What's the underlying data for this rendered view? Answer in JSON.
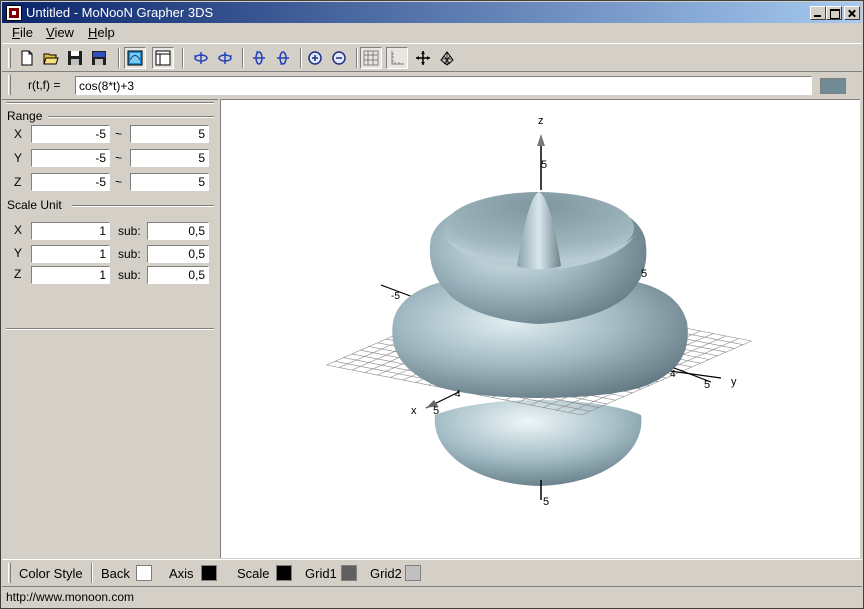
{
  "window": {
    "title": "Untitled - MoNooN Grapher 3DS"
  },
  "menu": {
    "file": "File",
    "view": "View",
    "help": "Help"
  },
  "toolbar": {
    "buttons": [
      "new-file-icon",
      "open-folder-icon",
      "save-icon",
      "save-bmp-icon",
      "view-graph-icon",
      "panel-toggle-icon",
      "rotate-left-icon",
      "rotate-right-icon",
      "tilt-up-icon",
      "tilt-down-icon",
      "zoom-in-icon",
      "zoom-out-icon",
      "grid-icon",
      "axis-icon",
      "move-icon",
      "mesh-icon"
    ]
  },
  "formula": {
    "label": "r(t,f) =",
    "value": "cos(8*t)+3",
    "color": "#6f8c94"
  },
  "range": {
    "title": "Range",
    "rows": [
      {
        "axis": "X",
        "min": "-5",
        "sep": "~",
        "max": "5"
      },
      {
        "axis": "Y",
        "min": "-5",
        "sep": "~",
        "max": "5"
      },
      {
        "axis": "Z",
        "min": "-5",
        "sep": "~",
        "max": "5"
      }
    ]
  },
  "scale_unit": {
    "title": "Scale Unit",
    "sub_label": "sub:",
    "rows": [
      {
        "axis": "X",
        "unit": "1",
        "sub": "0,5"
      },
      {
        "axis": "Y",
        "unit": "1",
        "sub": "0,5"
      },
      {
        "axis": "Z",
        "unit": "1",
        "sub": "0,5"
      }
    ]
  },
  "graph": {
    "axis_labels": {
      "x": "x",
      "y": "y",
      "z": "z"
    },
    "tick_labels": {
      "z_top": "5",
      "z_bottom": "5",
      "y_pos": "5",
      "y_neg": "5",
      "x_pos": "5",
      "x_neg": "-5",
      "x_tick4": "4",
      "y_tick4": "4"
    },
    "surface_color": "#9fb7c0"
  },
  "color_style": {
    "label": "Color Style",
    "back": {
      "label": "Back",
      "color": "#ffffff"
    },
    "axis": {
      "label": "Axis",
      "color": "#000000"
    },
    "scale": {
      "label": "Scale",
      "color": "#000000"
    },
    "grid1": {
      "label": "Grid1",
      "color": "#606060"
    },
    "grid2": {
      "label": "Grid2",
      "color": "#c0c0c0"
    }
  },
  "status": {
    "url": "http://www.monoon.com"
  }
}
